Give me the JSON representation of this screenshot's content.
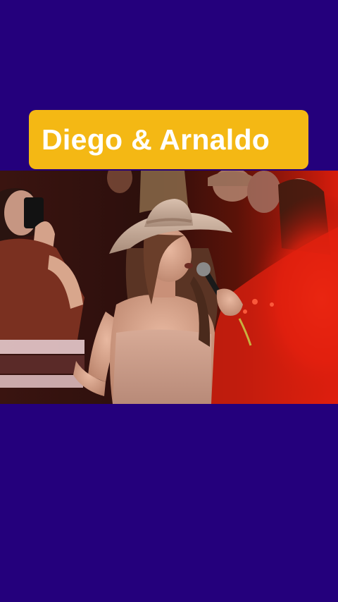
{
  "title": {
    "text": "Diego & Arnaldo"
  },
  "colors": {
    "background": "#24007c",
    "title_badge": "#f4b814",
    "title_text": "#ffffff",
    "stage_light": "#e3200f"
  },
  "video": {
    "description_icon": "concert-video-frame"
  }
}
